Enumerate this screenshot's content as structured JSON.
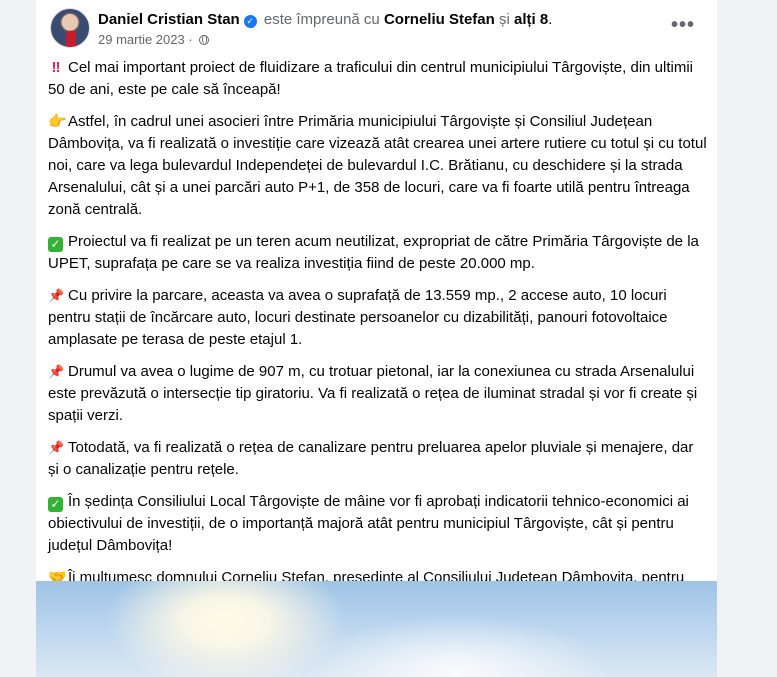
{
  "post": {
    "author": "Daniel Cristian Stan",
    "with_text": "este împreună cu",
    "tagged": "Corneliu Stefan",
    "and_text": "și",
    "others": "alți 8",
    "period": ".",
    "date": "29 martie 2023",
    "dot": " · ",
    "more_label": "•••",
    "paragraphs": [
      {
        "emoji": "‼",
        "text": "Cel mai important proiect de fluidizare a traficului din centrul municipiului Târgoviște, din ultimii 50 de ani, este pe cale să înceapă!"
      },
      {
        "emoji": "👉",
        "text": "Astfel, în cadrul unei asocieri între Primăria municipiului Târgoviște și Consiliul Județean Dâmbovița, va fi realizată o investiție care vizează atât crearea unei artere rutiere cu totul și cu totul noi, care va lega bulevardul Independeței de bulevardul I.C. Brătianu, cu deschidere și la strada Arsenalului, cât și a unei parcări auto P+1, de 358 de locuri, care va fi foarte utilă pentru întreaga zonă centrală."
      },
      {
        "emoji": "✓",
        "text": "Proiectul va fi realizat pe un teren acum neutilizat, expropriat de către Primăria Târgoviște de la UPET, suprafața pe care se va realiza investiția fiind de peste 20.000 mp."
      },
      {
        "emoji": "📌",
        "text": "Cu privire la parcare, aceasta va avea o suprafață de 13.559 mp., 2 accese auto, 10 locuri pentru stații de încărcare auto, locuri destinate persoanelor cu dizabilități, panouri fotovoltaice amplasate pe terasa de peste etajul 1."
      },
      {
        "emoji": "📌",
        "text": "Drumul va avea o lugime de 907 m, cu trotuar pietonal, iar la conexiunea cu strada Arsenalului este prevăzută o intersecție tip giratoriu. Va fi realizată o rețea de iluminat stradal și vor fi create și spații verzi."
      },
      {
        "emoji": "📌",
        "text": "Totodată, va fi realizată o rețea de canalizare pentru preluarea apelor pluviale și menajere, dar și o canalizație pentru rețele."
      },
      {
        "emoji": "✓",
        "text": "În ședința Consiliului Local Târgoviște de mâine vor fi aprobați indicatorii tehnico-economici ai obiectivului de investiții, de o importanță majoră atât pentru municipiul Târgoviște, cât și pentru județul Dâmbovița!"
      },
      {
        "emoji": "🤝",
        "text": "Îi mulțumesc domnului Corneliu Ștefan, președinte al Consiliului Județean Dâmbovița, pentru sprijinul acordat comunității târgoviștene, parteneriatul dintre administrația locală târgovișteană și cea județeană fiind unul stabil, cu beneficii importante pentru dâmbovițeni!"
      }
    ]
  },
  "colors": {
    "accent": "#1877f2",
    "muted": "#65676b",
    "background": "#f0f2f5"
  },
  "icons": [
    "verified-badge-icon",
    "globe-icon",
    "more-options-icon"
  ]
}
